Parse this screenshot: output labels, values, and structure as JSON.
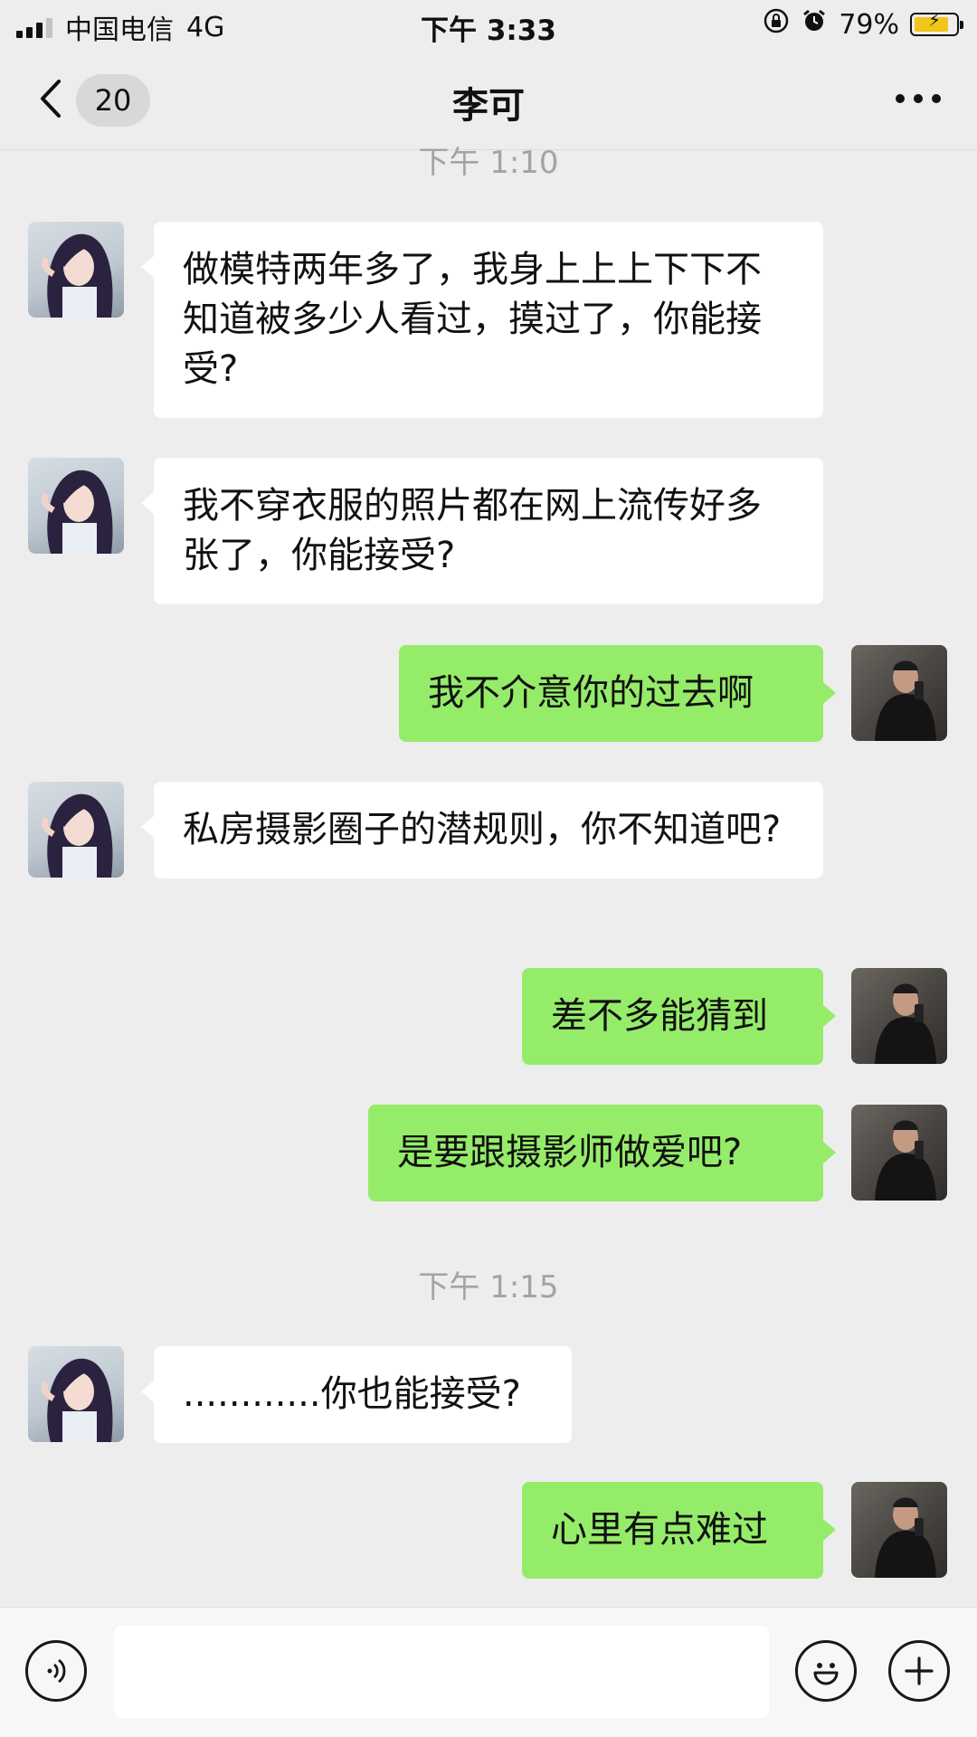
{
  "status_bar": {
    "carrier": "中国电信",
    "network": "4G",
    "time": "下午 3:33",
    "battery_percent": "79%"
  },
  "nav": {
    "unread_count": "20",
    "title": "李可"
  },
  "chat": {
    "timestamps": [
      "下午 1:10",
      "下午 1:15"
    ],
    "messages": [
      {
        "side": "received",
        "text": "做模特两年多了，我身上上上下下不知道被多少人看过，摸过了，你能接受?"
      },
      {
        "side": "received",
        "text": "我不穿衣服的照片都在网上流传好多张了，你能接受?"
      },
      {
        "side": "sent",
        "text": "我不介意你的过去啊"
      },
      {
        "side": "received",
        "text": "私房摄影圈子的潜规则，你不知道吧?"
      },
      {
        "side": "sent",
        "text": "差不多能猜到"
      },
      {
        "side": "sent",
        "text": "是要跟摄影师做爱吧?"
      },
      {
        "side": "received",
        "text": "............你也能接受?"
      },
      {
        "side": "sent",
        "text": "心里有点难过"
      }
    ]
  },
  "input_bar": {
    "value": ""
  },
  "colors": {
    "background": "#ededed",
    "sent_bubble": "#95ec69",
    "received_bubble": "#ffffff",
    "timestamp": "#a3a3a3"
  },
  "icons": {
    "back": "chevron-left-icon",
    "more": "more-dots-icon",
    "voice": "voice-icon",
    "emoji": "emoji-icon",
    "plus": "plus-icon"
  }
}
